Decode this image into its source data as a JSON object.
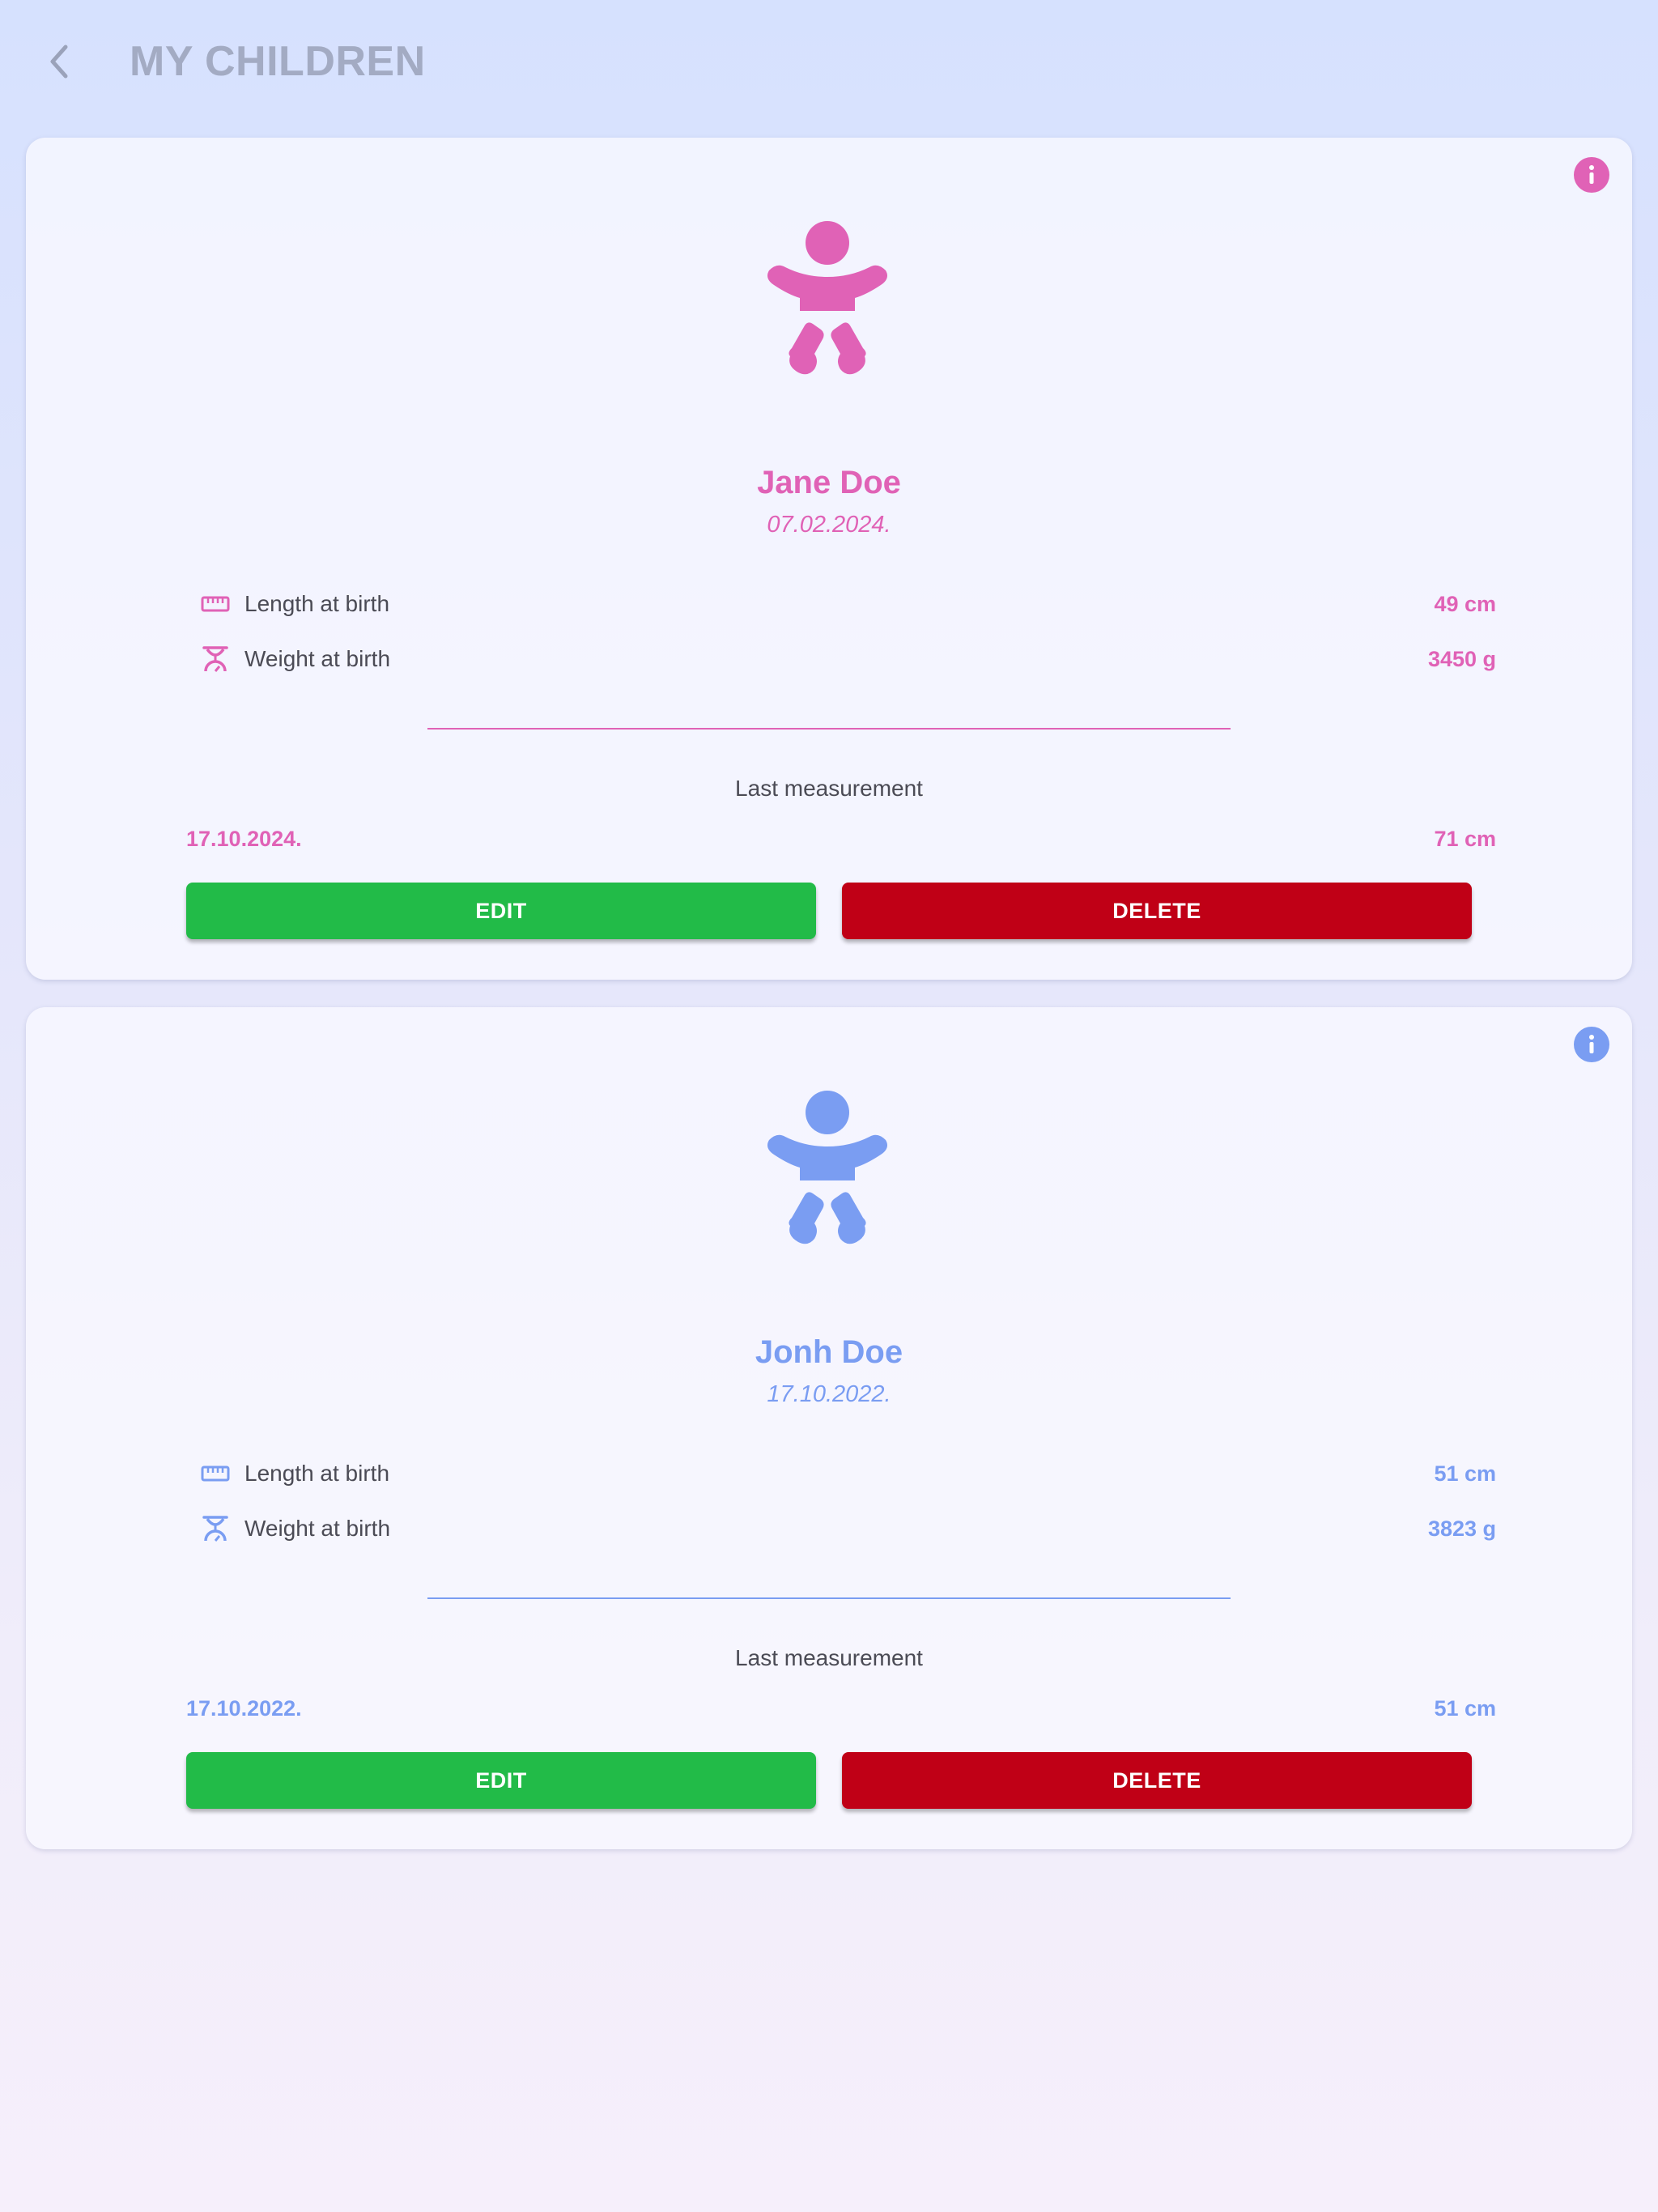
{
  "header": {
    "title": "MY CHILDREN",
    "back_icon": "chevron-left-icon"
  },
  "colors": {
    "girl_accent": "#e062b6",
    "boy_accent": "#7a9df2",
    "edit_button": "#22bb48",
    "delete_button": "#c00016",
    "title_gray": "#a3abc3",
    "label_text": "#4b4b55"
  },
  "children": [
    {
      "name": "Jane Doe",
      "birth_date": "07.02.2024.",
      "icon": "baby-icon",
      "length_label": "Length at birth",
      "length_icon": "ruler-icon",
      "length_value": "49 cm",
      "weight_label": "Weight at birth",
      "weight_icon": "scale-icon",
      "weight_value": "3450 g",
      "last_measurement_label": "Last measurement",
      "last_measurement_date": "17.10.2024.",
      "last_measurement_value": "71 cm",
      "edit_label": "EDIT",
      "delete_label": "DELETE",
      "info_icon": "info-icon"
    },
    {
      "name": "Jonh Doe",
      "birth_date": "17.10.2022.",
      "icon": "baby-icon",
      "length_label": "Length at birth",
      "length_icon": "ruler-icon",
      "length_value": "51 cm",
      "weight_label": "Weight at birth",
      "weight_icon": "scale-icon",
      "weight_value": "3823 g",
      "last_measurement_label": "Last measurement",
      "last_measurement_date": "17.10.2022.",
      "last_measurement_value": "51 cm",
      "edit_label": "EDIT",
      "delete_label": "DELETE",
      "info_icon": "info-icon"
    }
  ]
}
